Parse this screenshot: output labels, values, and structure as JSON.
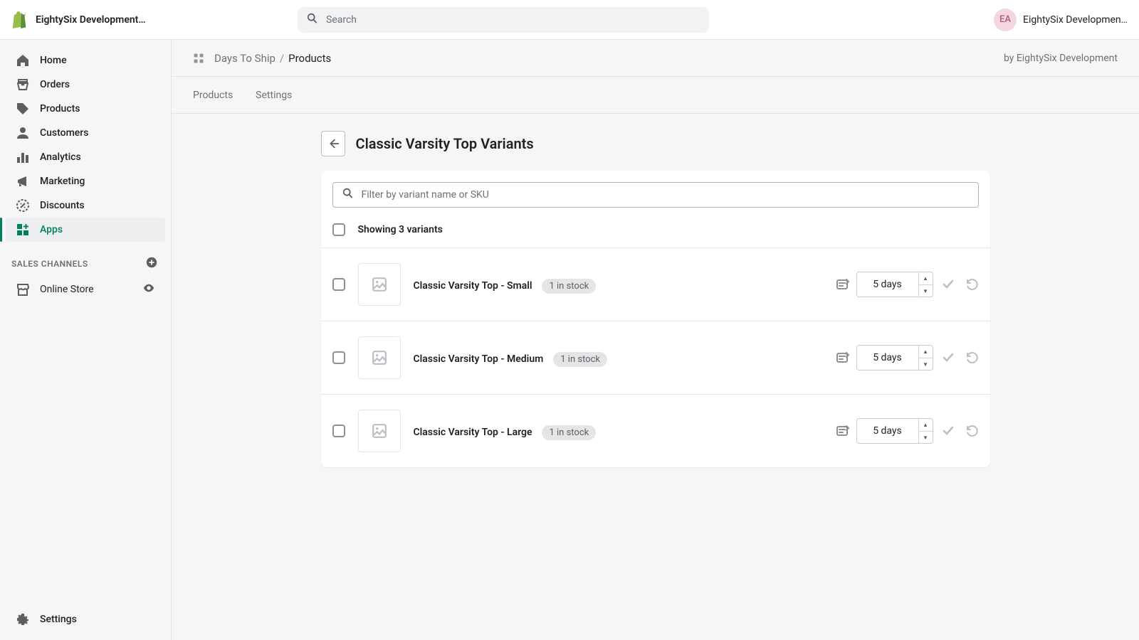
{
  "topbar": {
    "store_name": "EightySix Development…",
    "search_placeholder": "Search",
    "avatar_initials": "EA",
    "account_name": "EightySix Developmen…"
  },
  "sidebar": {
    "items": [
      {
        "label": "Home",
        "icon": "home-icon",
        "active": false
      },
      {
        "label": "Orders",
        "icon": "orders-icon",
        "active": false
      },
      {
        "label": "Products",
        "icon": "products-icon",
        "active": false
      },
      {
        "label": "Customers",
        "icon": "customers-icon",
        "active": false
      },
      {
        "label": "Analytics",
        "icon": "analytics-icon",
        "active": false
      },
      {
        "label": "Marketing",
        "icon": "marketing-icon",
        "active": false
      },
      {
        "label": "Discounts",
        "icon": "discounts-icon",
        "active": false
      },
      {
        "label": "Apps",
        "icon": "apps-icon",
        "active": true
      }
    ],
    "channels_heading": "SALES CHANNELS",
    "channels": [
      {
        "label": "Online Store",
        "icon": "store-icon"
      }
    ],
    "settings_label": "Settings"
  },
  "appbar": {
    "breadcrumb_parent": "Days To Ship",
    "breadcrumb_sep": "/",
    "breadcrumb_current": "Products",
    "byline": "by EightySix Development"
  },
  "tabs": {
    "products": "Products",
    "settings": "Settings"
  },
  "page": {
    "title": "Classic Varsity Top Variants",
    "filter_placeholder": "Filter by variant name or SKU",
    "showing_text": "Showing 3 variants"
  },
  "variants": [
    {
      "name": "Classic Varsity Top - Small",
      "stock": "1 in stock",
      "days": "5 days"
    },
    {
      "name": "Classic Varsity Top - Medium",
      "stock": "1 in stock",
      "days": "5 days"
    },
    {
      "name": "Classic Varsity Top - Large",
      "stock": "1 in stock",
      "days": "5 days"
    }
  ]
}
